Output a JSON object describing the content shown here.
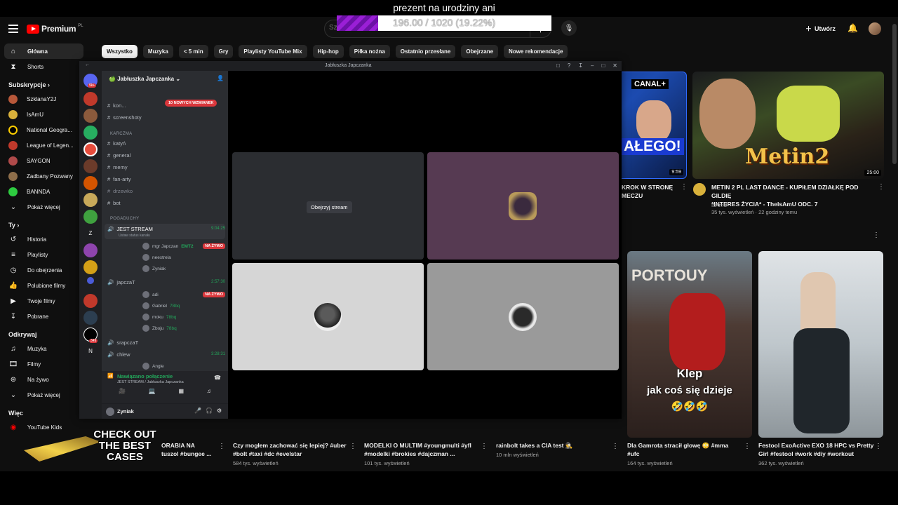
{
  "overlay": {
    "title": "prezent na urodziny ani",
    "progress_text": "196.00 / 1020 (19.22%)",
    "progress_fraction": 0.1922,
    "ad_line1": "CHECK OUT",
    "ad_line2": "THE BEST",
    "ad_line3": "CASES"
  },
  "youtube": {
    "logo": "Premium",
    "logo_country": "PL",
    "search_placeholder": "Szukaj",
    "create_label": "Utwórz",
    "chips": [
      "Wszystko",
      "Muzyka",
      "< 5 min",
      "Gry",
      "Playlisty YouTube Mix",
      "Hip-hop",
      "Piłka nożna",
      "Ostatnio przesłane",
      "Obejrzane",
      "Nowe rekomendacje"
    ],
    "sidebar": {
      "home": "Główna",
      "shorts": "Shorts",
      "subs_header": "Subskrypcje",
      "subs": [
        "SzklanaY2J",
        "IsAmU",
        "National Geogra...",
        "League of Legen...",
        "SAYGON",
        "Zadbany Pozwany",
        "BANNDA"
      ],
      "show_more": "Pokaż więcej",
      "you_header": "Ty",
      "you_items": [
        "Historia",
        "Playlisty",
        "Do obejrzenia",
        "Polubione filmy",
        "Twoje filmy",
        "Pobrane"
      ],
      "explore_header": "Odkrywaj",
      "explore_items": [
        "Muzyka",
        "Filmy",
        "Na żywo"
      ],
      "show_more2": "Pokaż więcej",
      "more_header": "Więc",
      "kids": "YouTube Kids"
    },
    "videos_top": [
      {
        "title_l1": "KROK W STRONĘ",
        "title_l2": "MECZU",
        "duration": "9:59",
        "badge": "CANAL+",
        "thumb_text": "AŁEGO!"
      },
      {
        "title_l1": "METIN 2 PL LAST DANCE - KUPIŁEM DZIAŁKĘ POD GILDIĘ",
        "title_l2": "*INTERES ŻYCIA* - TheIsAmU ODC. 7",
        "channel": "IsAmU",
        "meta": "35 tys. wyświetleń · 22 godziny temu",
        "duration": "25:00",
        "thumb_text": "Metin2"
      }
    ],
    "shorts": [
      {
        "title_l1": "ORABIA NA",
        "title_l2": "tuszol #bungee ..."
      },
      {
        "title_l1": "Czy mogłem zachować się lepiej? #uber",
        "title_l2": "#bolt #taxi #dc #evelstar",
        "meta": "584 tys. wyświetleń"
      },
      {
        "title_l1": "MODELKI O MULTIM #youngmulti #yfl",
        "title_l2": "#modelki #brokies #dajczman ...",
        "meta": "101 tys. wyświetleń"
      },
      {
        "title_l1": "rainbolt takes a CIA test 🕵️",
        "meta": "10 mln wyświetleń"
      },
      {
        "title_l1": "Dla Gamrota stracił głowę 😳 #mma",
        "title_l2": "#ufc",
        "meta": "164 tys. wyświetleń",
        "caption1": "Klep",
        "caption2": "jak coś się dzieje",
        "emoji": "🤣🤣🤣",
        "thumb_text": "PORTOUY"
      },
      {
        "title_l1": "Festool ExoActive EXO 18 HPC vs Pretty",
        "title_l2": "Girl #festool #work #diy #workout",
        "meta": "362 tys. wyświetleń"
      }
    ]
  },
  "discord": {
    "window_title": "Jabłuszka Japczanka",
    "server_name": "Jabłuszka Japczanka",
    "mention_badge": "10 NOWYCH WZMIANEK",
    "channels_top": [
      "kon...",
      "screenshoty"
    ],
    "cat_karczma": "KARCZMA",
    "karczma": [
      "katyń",
      "general",
      "memy",
      "fan-arty",
      "drzewko",
      "bot"
    ],
    "cat_pogaduchy": "POGADUCHY",
    "voice1": {
      "name": "JEST STREAM",
      "timer": "9:04:25",
      "status": "Ustaw status kanału"
    },
    "voice1_users": [
      "mgr Japczan",
      "neextrela",
      "Zyniak"
    ],
    "voice1_tag": "EMT2",
    "voice2": {
      "name": "japczaT",
      "timer": "2:57:30"
    },
    "voice2_users": [
      "adi",
      "Gabriel",
      "moku",
      "Zboju"
    ],
    "tag_78bq": "78bq",
    "voice3": {
      "name": "srapczaT"
    },
    "voice4": {
      "name": "chlew",
      "timer": "3:28:31"
    },
    "voice4_users": [
      "Angle"
    ],
    "live_label": "NA ŻYWO",
    "connected": "Nawiązano połączenie",
    "connected_sub": "JEST STREAM / Jabłuszka Japczanka",
    "user": "Zyniak",
    "watch_stream": "Obejrzyj stream",
    "guild_letters": [
      "Z",
      "N"
    ],
    "guild_badges": [
      "9k+",
      "3",
      "10",
      "8",
      "81",
      "2",
      "16",
      "349"
    ]
  },
  "colors": {
    "yt_bg": "#0f0f0f",
    "discord_green": "#23a55a",
    "live_red": "#da373c",
    "progress_purple": "#9a1fd6"
  }
}
